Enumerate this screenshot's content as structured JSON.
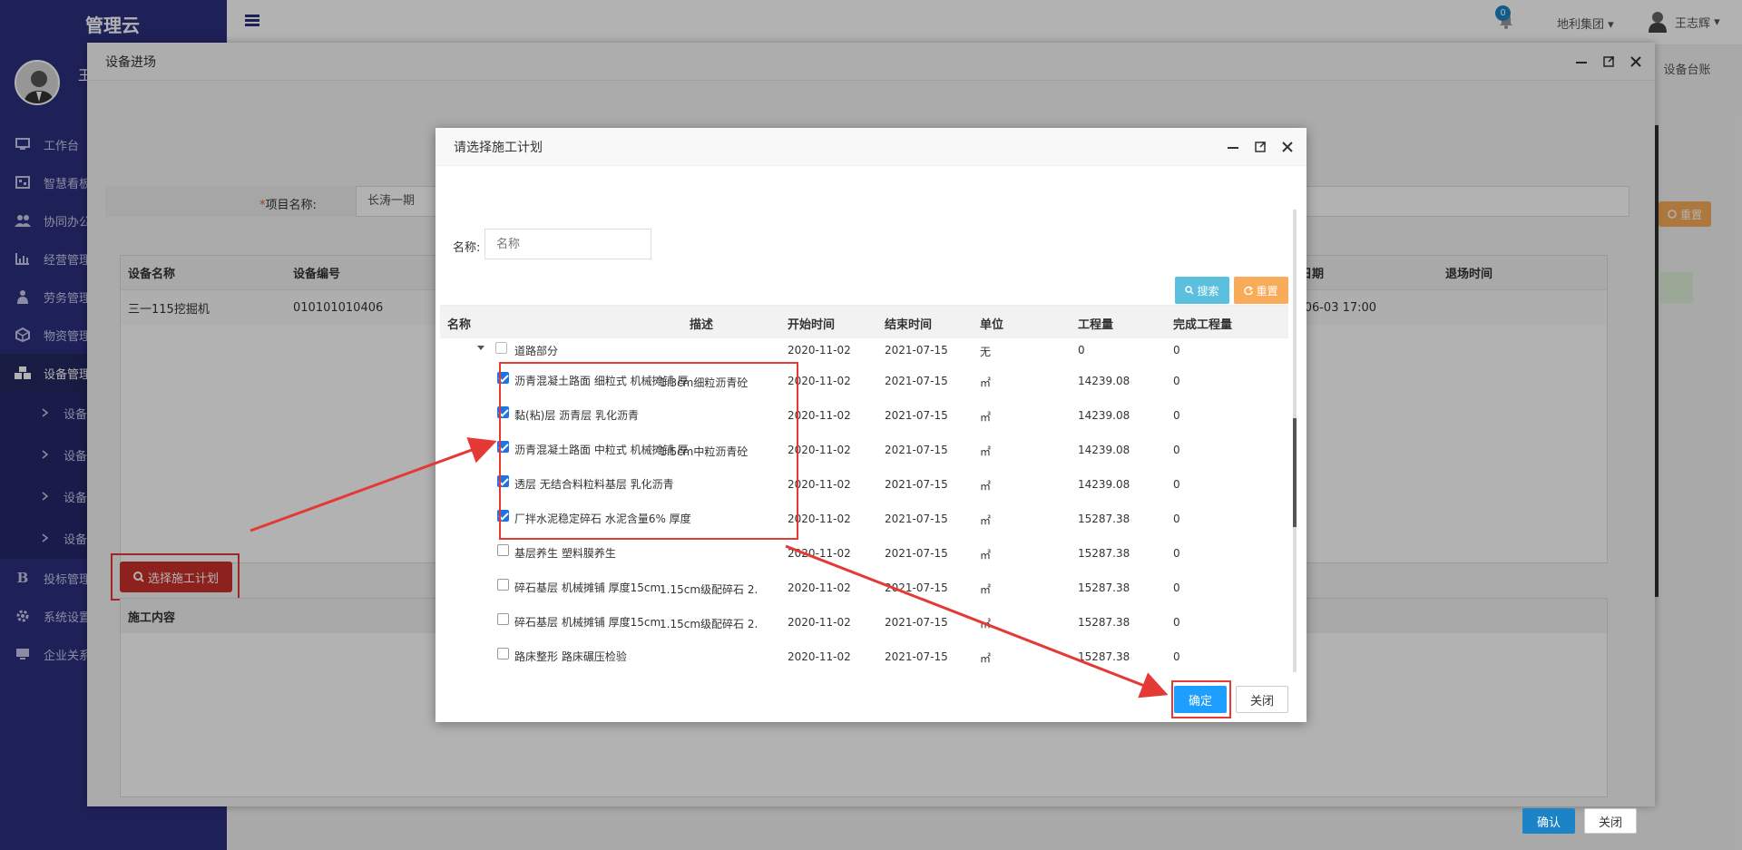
{
  "app": {
    "brand": "管理云",
    "user_short": "王"
  },
  "sidebar": {
    "items": [
      {
        "label": "工作台",
        "icon": "desktop-icon"
      },
      {
        "label": "智慧看板",
        "icon": "dashboard-icon"
      },
      {
        "label": "协同办公",
        "icon": "users-icon"
      },
      {
        "label": "经营管理",
        "icon": "chart-icon"
      },
      {
        "label": "劳务管理",
        "icon": "worker-icon"
      },
      {
        "label": "物资管理",
        "icon": "cube-icon"
      },
      {
        "label": "设备管理",
        "icon": "cubes-icon"
      }
    ],
    "sub_items": [
      {
        "label": "设备"
      },
      {
        "label": "设备"
      },
      {
        "label": "设备"
      },
      {
        "label": "设备"
      }
    ],
    "bottom_items": [
      {
        "label": "投标管理",
        "icon": "bold-b-icon"
      },
      {
        "label": "系统设置",
        "icon": "gear-icon"
      },
      {
        "label": "企业关系",
        "icon": "monitor-icon"
      }
    ]
  },
  "topbar": {
    "bell_count": "0",
    "org": "地利集团",
    "user": "王志辉"
  },
  "breadcrumb": {
    "sep": "›",
    "current": "设备台账"
  },
  "background": {
    "reset_label": "重置"
  },
  "outer_modal": {
    "title": "设备进场",
    "project_label": "项目名称:",
    "project_required": "*",
    "project_value": "长涛一期",
    "eq_headers": [
      "设备名称",
      "设备编号",
      "日期",
      "退场时间"
    ],
    "eq_rows": [
      {
        "name": "三一115挖掘机",
        "code": "010101010406",
        "date": "-06-03 17:00",
        "exit": ""
      }
    ],
    "select_plan_label": "选择施工计划",
    "content_header": "施工内容",
    "confirm_label": "确认",
    "close_label": "关闭"
  },
  "dialog": {
    "title": "请选择施工计划",
    "name_label": "名称:",
    "name_placeholder": "名称",
    "search_label": "搜索",
    "reset_label": "重置",
    "headers": [
      "名称",
      "描述",
      "开始时间",
      "结束时间",
      "单位",
      "工程量",
      "完成工程量"
    ],
    "group_row": {
      "name": "道路部分",
      "start": "2020-11-02",
      "end": "2021-07-15",
      "unit": "无",
      "qty": "0",
      "done": "0"
    },
    "rows": [
      {
        "name": "沥青混凝土路面 细粒式 机械摊铺 厚",
        "desc": "1.3cm细粒沥青砼",
        "start": "2020-11-02",
        "end": "2021-07-15",
        "unit": "㎡",
        "qty": "14239.08",
        "done": "0",
        "checked": true
      },
      {
        "name": "黏(粘)层 沥青层 乳化沥青",
        "desc": "",
        "start": "2020-11-02",
        "end": "2021-07-15",
        "unit": "㎡",
        "qty": "14239.08",
        "done": "0",
        "checked": true
      },
      {
        "name": "沥青混凝土路面 中粒式 机械摊铺 厚",
        "desc": "1.5cm中粒沥青砼",
        "start": "2020-11-02",
        "end": "2021-07-15",
        "unit": "㎡",
        "qty": "14239.08",
        "done": "0",
        "checked": true
      },
      {
        "name": "透层 无结合料粒料基层 乳化沥青",
        "desc": "",
        "start": "2020-11-02",
        "end": "2021-07-15",
        "unit": "㎡",
        "qty": "14239.08",
        "done": "0",
        "checked": true
      },
      {
        "name": "厂拌水泥稳定碎石 水泥含量6% 厚度",
        "desc": "",
        "start": "2020-11-02",
        "end": "2021-07-15",
        "unit": "㎡",
        "qty": "15287.38",
        "done": "0",
        "checked": true
      },
      {
        "name": "基层养生 塑料膜养生",
        "desc": "",
        "start": "2020-11-02",
        "end": "2021-07-15",
        "unit": "㎡",
        "qty": "15287.38",
        "done": "0",
        "checked": false
      },
      {
        "name": "碎石基层 机械摊铺 厚度15cm",
        "desc": "1.15cm级配碎石 2.",
        "start": "2020-11-02",
        "end": "2021-07-15",
        "unit": "㎡",
        "qty": "15287.38",
        "done": "0",
        "checked": false
      },
      {
        "name": "碎石基层 机械摊铺 厚度15cm",
        "desc": "1.15cm级配碎石 2.",
        "start": "2020-11-02",
        "end": "2021-07-15",
        "unit": "㎡",
        "qty": "15287.38",
        "done": "0",
        "checked": false
      },
      {
        "name": "路床整形 路床碾压检验",
        "desc": "",
        "start": "2020-11-02",
        "end": "2021-07-15",
        "unit": "㎡",
        "qty": "15287.38",
        "done": "0",
        "checked": false
      }
    ],
    "ok_label": "确定",
    "close_label": "关闭"
  },
  "colors": {
    "sidebar": "#2b2f7e",
    "danger": "#c9302c",
    "primary": "#1e9fff",
    "annotation": "#e53935"
  }
}
